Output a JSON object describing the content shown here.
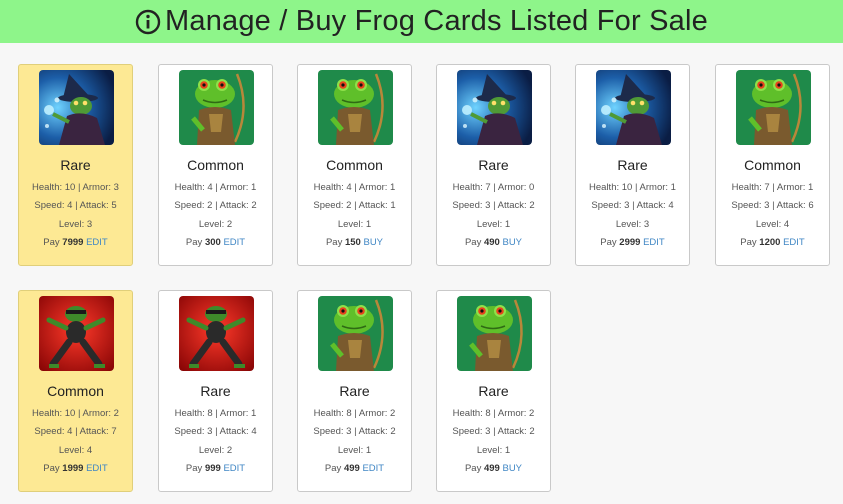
{
  "header": {
    "title": "Manage / Buy Frog Cards Listed For Sale",
    "icon": "info-circle-icon",
    "bg": "#8ef58a"
  },
  "labels": {
    "pay": "Pay"
  },
  "cards": [
    {
      "art": "wizard",
      "rarity": "Rare",
      "health_armor": "Health: 10 | Armor: 3",
      "speed_attack": "Speed: 4 | Attack: 5",
      "level": "Level: 3",
      "price": "7999",
      "action": "EDIT",
      "highlight": true
    },
    {
      "art": "archer",
      "rarity": "Common",
      "health_armor": "Health: 4 | Armor: 1",
      "speed_attack": "Speed: 2 | Attack: 2",
      "level": "Level: 2",
      "price": "300",
      "action": "EDIT",
      "highlight": false
    },
    {
      "art": "archer",
      "rarity": "Common",
      "health_armor": "Health: 4 | Armor: 1",
      "speed_attack": "Speed: 2 | Attack: 1",
      "level": "Level: 1",
      "price": "150",
      "action": "BUY",
      "highlight": false
    },
    {
      "art": "wizard",
      "rarity": "Rare",
      "health_armor": "Health: 7 | Armor: 0",
      "speed_attack": "Speed: 3 | Attack: 2",
      "level": "Level: 1",
      "price": "490",
      "action": "BUY",
      "highlight": false
    },
    {
      "art": "wizard",
      "rarity": "Rare",
      "health_armor": "Health: 10 | Armor: 1",
      "speed_attack": "Speed: 3 | Attack: 4",
      "level": "Level: 3",
      "price": "2999",
      "action": "EDIT",
      "highlight": false
    },
    {
      "art": "archer",
      "rarity": "Common",
      "health_armor": "Health: 7 | Armor: 1",
      "speed_attack": "Speed: 3 | Attack: 6",
      "level": "Level: 4",
      "price": "1200",
      "action": "EDIT",
      "highlight": false
    },
    {
      "art": "ninja",
      "rarity": "Common",
      "health_armor": "Health: 10 | Armor: 2",
      "speed_attack": "Speed: 4 | Attack: 7",
      "level": "Level: 4",
      "price": "1999",
      "action": "EDIT",
      "highlight": true
    },
    {
      "art": "ninja",
      "rarity": "Rare",
      "health_armor": "Health: 8 | Armor: 1",
      "speed_attack": "Speed: 3 | Attack: 4",
      "level": "Level: 2",
      "price": "999",
      "action": "EDIT",
      "highlight": false
    },
    {
      "art": "archer",
      "rarity": "Rare",
      "health_armor": "Health: 8 | Armor: 2",
      "speed_attack": "Speed: 3 | Attack: 2",
      "level": "Level: 1",
      "price": "499",
      "action": "EDIT",
      "highlight": false
    },
    {
      "art": "archer",
      "rarity": "Rare",
      "health_armor": "Health: 8 | Armor: 2",
      "speed_attack": "Speed: 3 | Attack: 2",
      "level": "Level: 1",
      "price": "499",
      "action": "BUY",
      "highlight": false
    }
  ]
}
